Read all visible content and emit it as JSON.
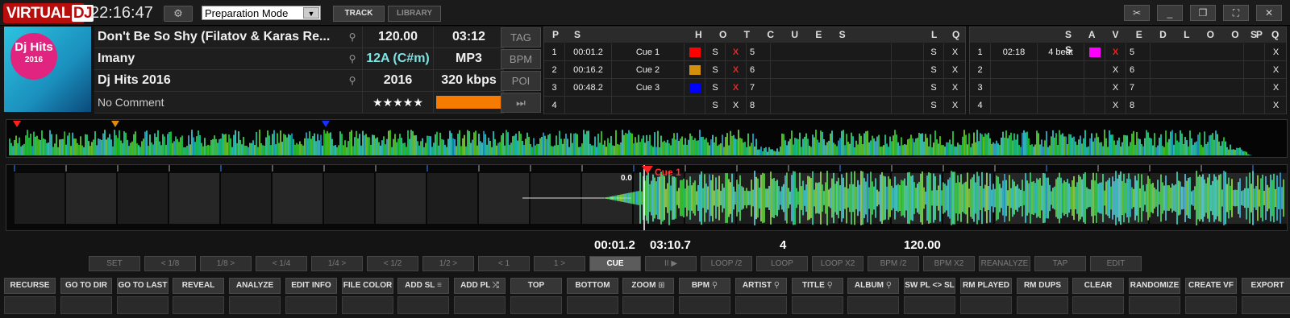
{
  "app": {
    "logo_main": "VIRTUAL",
    "logo_dj": "DJ",
    "clock": "22:16:47",
    "mode": "Preparation Mode",
    "nav_track": "TRACK",
    "nav_library": "LIBRARY"
  },
  "track": {
    "title": "Don't Be So Shy (Filatov & Karas Re...",
    "artist": "Imany",
    "album": "Dj Hits 2016",
    "comment": "No Comment",
    "bpm": "120.00",
    "length": "03:12",
    "key": "12A (C#m)",
    "format": "MP3",
    "year": "2016",
    "bitrate": "320 kbps",
    "rating": "★★★★★",
    "color": "#f57c00",
    "cover_text": "Dj Hits",
    "cover_year": "2016"
  },
  "side_buttons": [
    "TAG",
    "BPM",
    "POI",
    "⏭"
  ],
  "hotcues": {
    "header_p": "P",
    "header_s": "S",
    "header_title": "H O T C U E S",
    "header_l": "L",
    "header_q": "Q",
    "rows": [
      {
        "num": "1",
        "time": "00:01.2",
        "name": "Cue 1",
        "color": "#ff0000",
        "s": "S",
        "x": "X",
        "num2": "5",
        "s2": "S",
        "x2": "X"
      },
      {
        "num": "2",
        "time": "00:16.2",
        "name": "Cue 2",
        "color": "#d4900a",
        "s": "S",
        "x": "X",
        "num2": "6",
        "s2": "S",
        "x2": "X"
      },
      {
        "num": "3",
        "time": "00:48.2",
        "name": "Cue 3",
        "color": "#0000ff",
        "s": "S",
        "x": "X",
        "num2": "7",
        "s2": "S",
        "x2": "X"
      },
      {
        "num": "4",
        "time": "",
        "name": "",
        "color": "",
        "s": "S",
        "x": "X",
        "num2": "8",
        "s2": "S",
        "x2": "X"
      }
    ]
  },
  "saved_loops": {
    "header_title": "S A V E D   L O O P S",
    "header_s": "S",
    "header_q": "Q",
    "rows": [
      {
        "num": "1",
        "time": "02:18",
        "name": "4 beat",
        "color": "#ff00ff",
        "x": "X",
        "num2": "5",
        "x2": "X"
      },
      {
        "num": "2",
        "time": "",
        "name": "",
        "color": "",
        "x": "X",
        "num2": "6",
        "x2": "X"
      },
      {
        "num": "3",
        "time": "",
        "name": "",
        "color": "",
        "x": "X",
        "num2": "7",
        "x2": "X"
      },
      {
        "num": "4",
        "time": "",
        "name": "",
        "color": "",
        "x": "X",
        "num2": "8",
        "x2": "X"
      }
    ]
  },
  "waveform": {
    "cue_label": "Cue 1",
    "counter": "0.0",
    "elapsed": "00:01.2",
    "remain": "03:10.7",
    "beat": "4",
    "bpm": "120.00"
  },
  "transport": [
    "SET",
    "< 1/8",
    "1/8 >",
    "< 1/4",
    "1/4 >",
    "< 1/2",
    "1/2 >",
    "< 1",
    "1 >",
    "CUE",
    "II ▶",
    "LOOP /2",
    "LOOP",
    "LOOP X2",
    "BPM /2",
    "BPM X2",
    "REANALYZE",
    "TAP",
    "EDIT"
  ],
  "toolbar": [
    "RECURSE",
    "GO TO DIR",
    "GO TO LAST",
    "REVEAL",
    "ANALYZE",
    "EDIT INFO",
    "FILE COLOR",
    "ADD SL",
    "ADD PL",
    "TOP",
    "BOTTOM",
    "ZOOM",
    "BPM",
    "ARTIST",
    "TITLE",
    "ALBUM",
    "SW PL <> SL",
    "RM PLAYED",
    "RM DUPS",
    "CLEAR",
    "RANDOMIZE",
    "CREATE VF",
    "EXPORT"
  ],
  "colors": {
    "accent_red": "#b80d0d",
    "key_color": "#7fe3e3",
    "cue_marker": "#ff2020"
  }
}
